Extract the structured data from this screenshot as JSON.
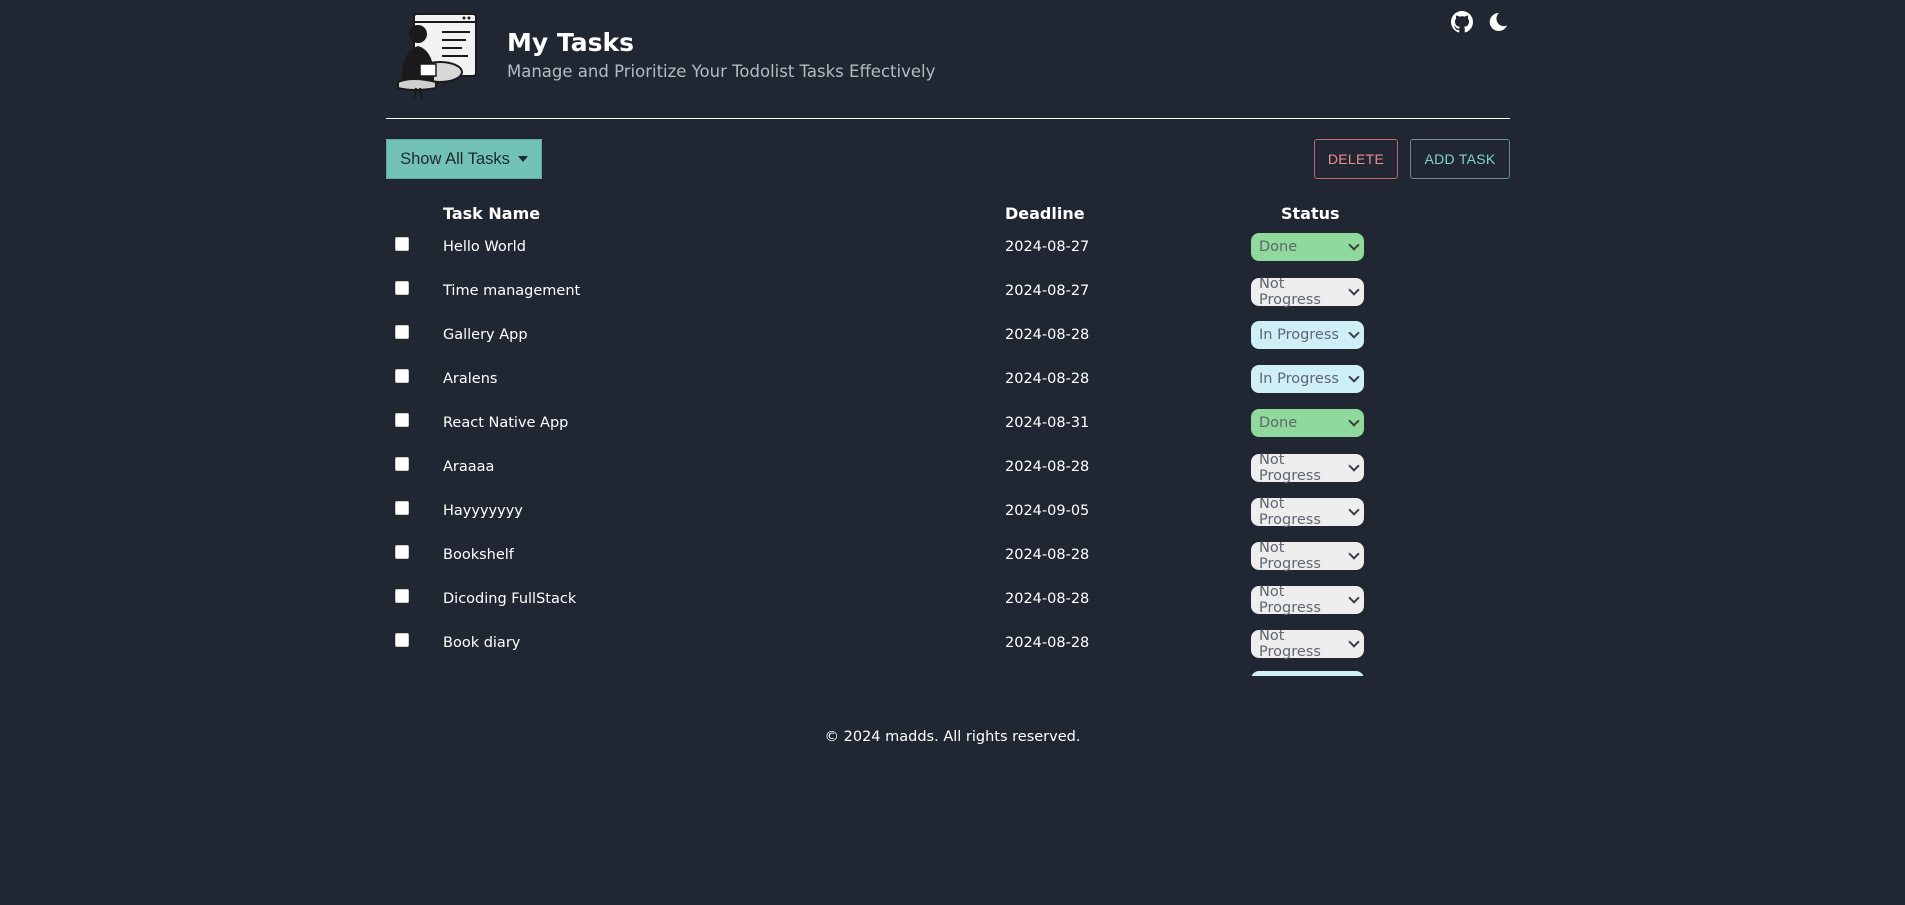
{
  "header": {
    "title": "My Tasks",
    "subtitle": "Manage and Prioritize Your Todolist Tasks Effectively"
  },
  "toolbar": {
    "filter_label": "Show All Tasks",
    "delete_label": "DELETE",
    "add_label": "ADD TASK"
  },
  "table": {
    "columns": [
      "Task Name",
      "Deadline",
      "Status"
    ],
    "rows": [
      {
        "name": "Hello World",
        "deadline": "2024-08-27",
        "status": "Done"
      },
      {
        "name": "Time management",
        "deadline": "2024-08-27",
        "status": "Not Progress"
      },
      {
        "name": "Gallery App",
        "deadline": "2024-08-28",
        "status": "In Progress"
      },
      {
        "name": "Aralens",
        "deadline": "2024-08-28",
        "status": "In Progress"
      },
      {
        "name": "React Native App",
        "deadline": "2024-08-31",
        "status": "Done"
      },
      {
        "name": "Araaaa",
        "deadline": "2024-08-28",
        "status": "Not Progress"
      },
      {
        "name": "Hayyyyyyy",
        "deadline": "2024-09-05",
        "status": "Not Progress"
      },
      {
        "name": "Bookshelf",
        "deadline": "2024-08-28",
        "status": "Not Progress"
      },
      {
        "name": "Dicoding FullStack",
        "deadline": "2024-08-28",
        "status": "Not Progress"
      },
      {
        "name": "Book diary",
        "deadline": "2024-08-28",
        "status": "Not Progress"
      }
    ]
  },
  "status_colors": {
    "Done": "#8ed99b",
    "Not Progress": "#eeeeee",
    "In Progress": "#cfeff7"
  },
  "icons": {
    "github": "github-icon",
    "theme": "moon-icon"
  },
  "footer": {
    "text": "© 2024 madds. All rights reserved."
  }
}
